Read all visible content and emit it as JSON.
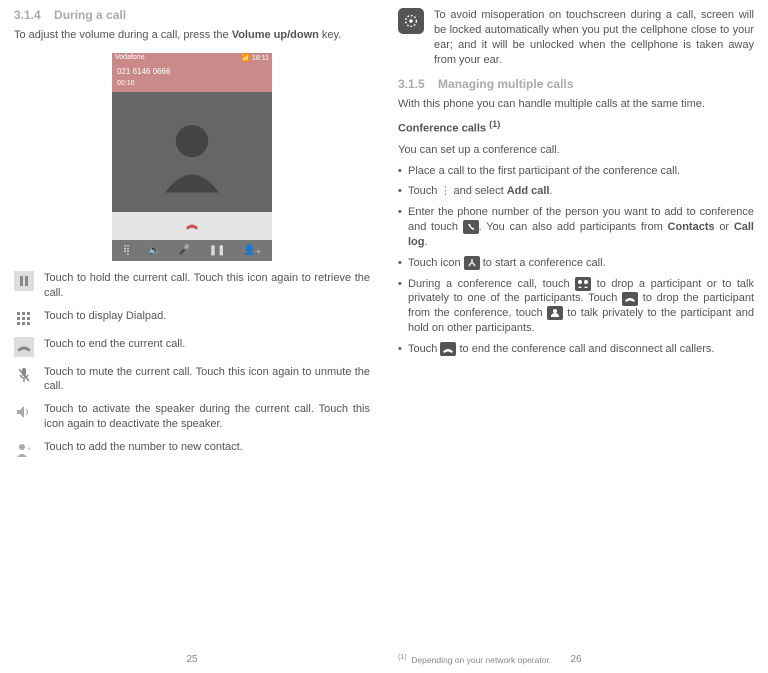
{
  "left": {
    "heading_num": "3.1.4",
    "heading_txt": "During a call",
    "intro_a": "To adjust the volume during a call, press the ",
    "intro_bold": "Volume up/down",
    "intro_b": " key.",
    "phone": {
      "carrier": "Vodafone",
      "time": "18:11",
      "number": "021 6146 0666",
      "duration": "00:10"
    },
    "icons": {
      "hold": "Touch to hold the current call. Touch this icon again to retrieve the call.",
      "dialpad": "Touch to display Dialpad.",
      "end": "Touch to end the current call.",
      "mute": "Touch to mute the current call. Touch this icon again to unmute the call.",
      "speaker": "Touch to activate the speaker during the current call. Touch this icon again to deactivate the speaker.",
      "add": "Touch to add the number to new contact."
    },
    "page": "25"
  },
  "right": {
    "note": "To avoid misoperation on touchscreen during a call, screen will be locked automatically when you put the cellphone close to your ear; and it will be unlocked when the cellphone is taken away from your ear.",
    "heading_num": "3.1.5",
    "heading_txt": "Managing multiple calls",
    "intro": "With this phone you can handle multiple calls at the same time.",
    "conf_heading": "Conference calls",
    "conf_sup": "(1)",
    "conf_intro": "You can set up a conference call.",
    "b1": "Place a call to the first participant of the conference call.",
    "b2a": "Touch ",
    "b2b": " and select ",
    "b2bold": "Add call",
    "b2c": ".",
    "b3a": "Enter the phone number of the person you want to add to conference and touch ",
    "b3b": ". You can also add participants from ",
    "b3bold1": "Contacts",
    "b3mid": " or ",
    "b3bold2": "Call log",
    "b3c": ".",
    "b4a": "Touch icon ",
    "b4b": " to start a conference call.",
    "b5a": "During a conference call, touch ",
    "b5b": " to drop a participant or to talk privately to one of the participants. Touch ",
    "b5c": " to drop the participant from the conference, touch ",
    "b5d": " to talk privately to the participant and hold on other participants.",
    "b6a": "Touch ",
    "b6b": " to end the conference call and disconnect all callers.",
    "footnote": "Depending on your network operator.",
    "page": "26"
  }
}
